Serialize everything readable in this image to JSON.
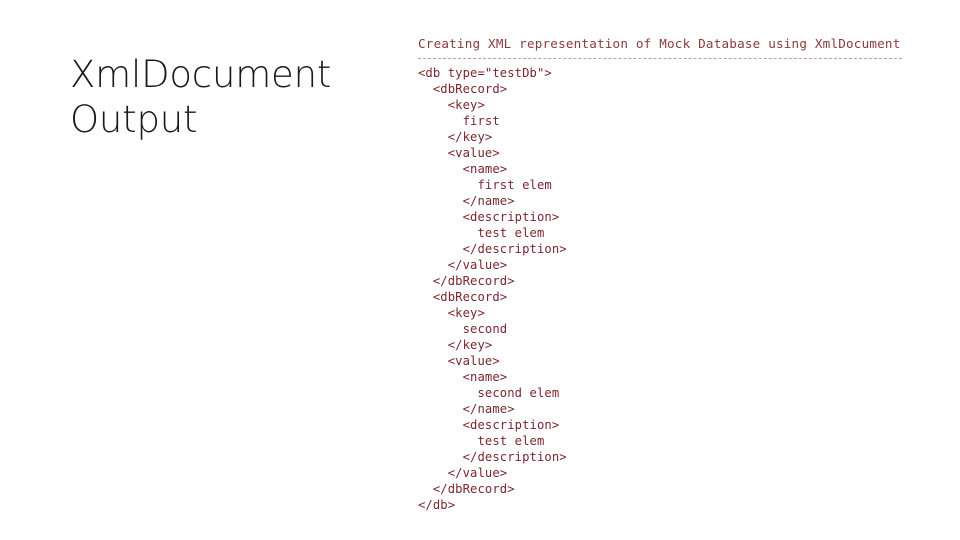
{
  "slide": {
    "background_color": "#ffffff",
    "title": "XmlDocument\nOutput"
  },
  "code_panel": {
    "header": "Creating XML representation of Mock Database using XmlDocument",
    "divider_style": "dashed",
    "divider_color": "#c89b9b",
    "text_color": "#7c2630",
    "header_color": "#8a3b3b",
    "lines": [
      "<db type=\"testDb\">",
      "  <dbRecord>",
      "    <key>",
      "      first",
      "    </key>",
      "    <value>",
      "      <name>",
      "        first elem",
      "      </name>",
      "      <description>",
      "        test elem",
      "      </description>",
      "    </value>",
      "  </dbRecord>",
      "  <dbRecord>",
      "    <key>",
      "      second",
      "    </key>",
      "    <value>",
      "      <name>",
      "        second elem",
      "      </name>",
      "      <description>",
      "        test elem",
      "      </description>",
      "    </value>",
      "  </dbRecord>",
      "</db>"
    ]
  }
}
